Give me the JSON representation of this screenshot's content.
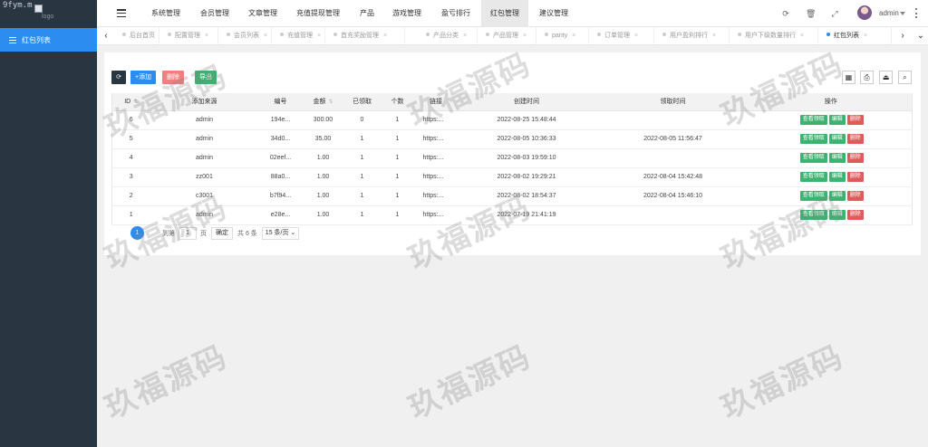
{
  "logo": {
    "text": "9fym.m",
    "alt": "logo"
  },
  "sidebar": {
    "items": [
      {
        "label": "红包列表"
      }
    ]
  },
  "topnav": {
    "items": [
      {
        "label": "系统管理"
      },
      {
        "label": "会员管理"
      },
      {
        "label": "文章管理"
      },
      {
        "label": "充值提现管理"
      },
      {
        "label": "产品"
      },
      {
        "label": "游戏管理"
      },
      {
        "label": "盈亏排行"
      },
      {
        "label": "红包管理"
      },
      {
        "label": "建议管理"
      }
    ],
    "active_index": 7,
    "user": "admin"
  },
  "tabs": [
    {
      "label": "后台首页"
    },
    {
      "label": "配置管理"
    },
    {
      "label": "会员列表"
    },
    {
      "label": "充值管理"
    },
    {
      "label": "首充奖励管理"
    },
    {
      "label": "产品分类"
    },
    {
      "label": "产品管理"
    },
    {
      "label": "parity"
    },
    {
      "label": "订单管理"
    },
    {
      "label": "用户盈利排行"
    },
    {
      "label": "用户下级数量排行"
    },
    {
      "label": "红包列表"
    }
  ],
  "toolbar": {
    "add": "+添加",
    "delete": "删除",
    "export": "导出"
  },
  "table": {
    "headers": [
      "ID",
      "添加来源",
      "编号",
      "金额",
      "已领取",
      "个数",
      "链接",
      "创建时间",
      "领取时间",
      "操作"
    ],
    "rows": [
      {
        "id": "6",
        "source": "admin",
        "code": "194e...",
        "amount": "300.00",
        "received": "0",
        "count": "1",
        "link": "https:...",
        "created": "2022-08-25 15:48:44",
        "claimed": ""
      },
      {
        "id": "5",
        "source": "admin",
        "code": "34d0...",
        "amount": "35.00",
        "received": "1",
        "count": "1",
        "link": "https:...",
        "created": "2022-08-05 10:36:33",
        "claimed": "2022-08-05 11:56:47"
      },
      {
        "id": "4",
        "source": "admin",
        "code": "02eef...",
        "amount": "1.00",
        "received": "1",
        "count": "1",
        "link": "https:...",
        "created": "2022-08-03 19:59:10",
        "claimed": ""
      },
      {
        "id": "3",
        "source": "zz001",
        "code": "88a0...",
        "amount": "1.00",
        "received": "1",
        "count": "1",
        "link": "https:...",
        "created": "2022-08-02 19:29:21",
        "claimed": "2022-08-04 15:42:48"
      },
      {
        "id": "2",
        "source": "c3001",
        "code": "b7f94...",
        "amount": "1.00",
        "received": "1",
        "count": "1",
        "link": "https:...",
        "created": "2022-08-02 18:54:37",
        "claimed": "2022-08-04 15:46:10"
      },
      {
        "id": "1",
        "source": "admin",
        "code": "e28e...",
        "amount": "1.00",
        "received": "1",
        "count": "1",
        "link": "https:...",
        "created": "2022-07-19 21:41:19",
        "claimed": ""
      }
    ],
    "actions": {
      "view": "查看领取",
      "edit": "编辑",
      "delete": "删除"
    }
  },
  "pager": {
    "current": "1",
    "goto_prefix": "到第",
    "page_input": "1",
    "page_suffix": "页",
    "confirm": "确定",
    "total": "共 6 条",
    "page_size": "15 条/页"
  },
  "watermark": "玖福源码"
}
